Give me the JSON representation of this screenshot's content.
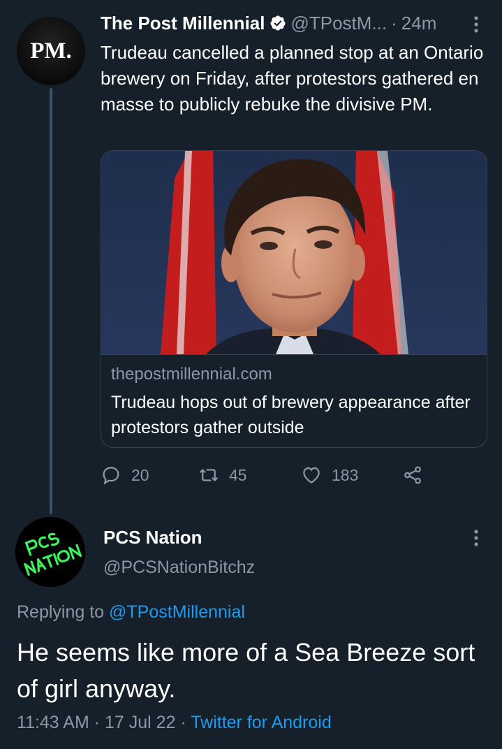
{
  "parent_tweet": {
    "avatar_text": "PM.",
    "display_name": "The Post Millennial",
    "handle": "@TPostM...",
    "separator": "·",
    "time": "24m",
    "text": "Trudeau cancelled a planned stop at an Ontario brewery on Friday, after protestors gathered en masse to publicly rebuke the divisive PM.",
    "card": {
      "domain": "thepostmillennial.com",
      "title": "Trudeau hops out of brewery appearance after protestors gather outside",
      "image_icon": "photo-of-man-with-red-flag-background"
    },
    "actions": {
      "replies": "20",
      "retweets": "45",
      "likes": "183"
    }
  },
  "reply_tweet": {
    "avatar_text": "PCS NATION",
    "display_name": "PCS Nation",
    "handle": "@PCSNationBitchz",
    "replying_prefix": "Replying to",
    "replying_to": "@TPostMillennial",
    "text": "He seems like more of a Sea Breeze sort of girl anyway.",
    "time": "11:43 AM",
    "separator": "·",
    "date": "17 Jul 22",
    "source": "Twitter for Android"
  },
  "colors": {
    "background": "#15202b",
    "secondary_text": "#8b98a5",
    "link": "#1d9bf0",
    "border": "#38444d",
    "avatar_accent": "#3bf05a"
  }
}
